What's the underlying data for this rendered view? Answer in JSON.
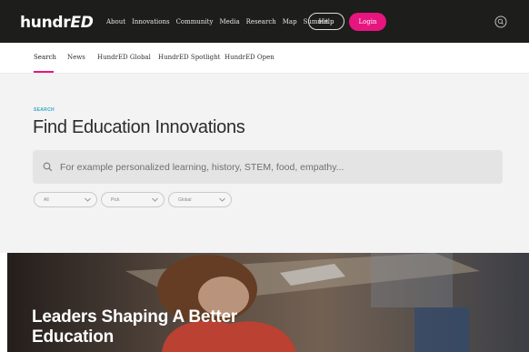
{
  "header": {
    "logo_main": "hundr",
    "logo_accent": "ED",
    "menu": [
      "About",
      "Innovations",
      "Community",
      "Media",
      "Research",
      "Map",
      "Summit"
    ],
    "help_label": "Help",
    "login_label": "Login"
  },
  "subnav": {
    "items": [
      "Search",
      "News",
      "HundrED Global",
      "HundrED Spotlight",
      "HundrED Open"
    ]
  },
  "search": {
    "eyebrow": "SEARCH",
    "title": "Find Education Innovations",
    "placeholder": "For example personalized learning, history, STEM, food, empathy..."
  },
  "filters": [
    "All",
    "Pick",
    "Global"
  ],
  "hero": {
    "title": "Leaders Shaping A Better Education"
  },
  "colors": {
    "nav_bg": "#1d1d1b",
    "accent_pink": "#e7157f",
    "eyebrow_blue": "#34a7c4",
    "section_bg": "#f3f3f3"
  }
}
